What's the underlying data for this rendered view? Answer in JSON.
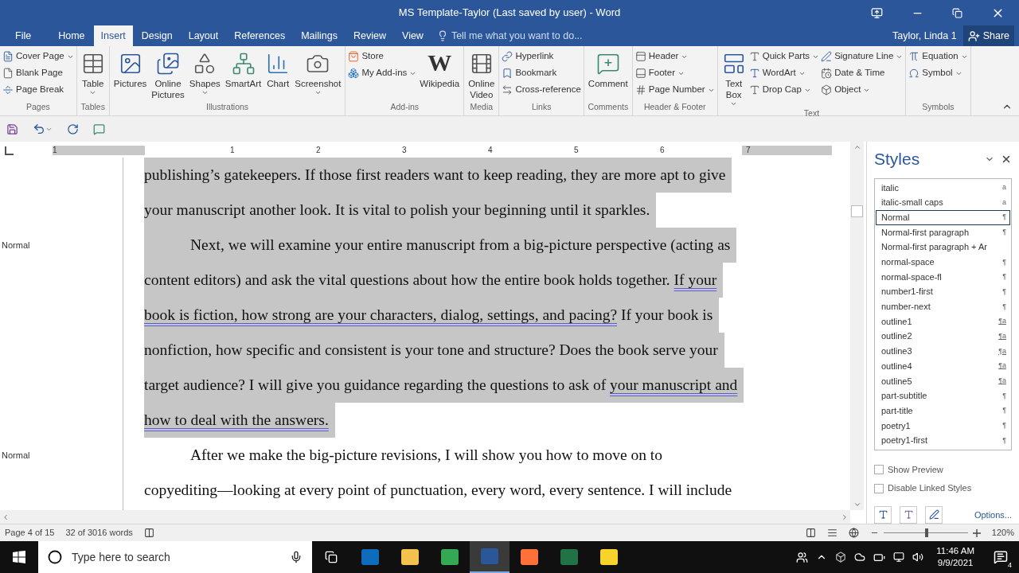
{
  "window": {
    "title": "MS Template-Taylor (Last saved by user) - Word"
  },
  "tabs": [
    {
      "label": "File",
      "selected": false
    },
    {
      "label": "Home",
      "selected": false
    },
    {
      "label": "Insert",
      "selected": true
    },
    {
      "label": "Design",
      "selected": false
    },
    {
      "label": "Layout",
      "selected": false
    },
    {
      "label": "References",
      "selected": false
    },
    {
      "label": "Mailings",
      "selected": false
    },
    {
      "label": "Review",
      "selected": false
    },
    {
      "label": "View",
      "selected": false
    }
  ],
  "tell_me": {
    "placeholder": "Tell me what you want to do..."
  },
  "user": "Taylor, Linda 1",
  "share": "Share",
  "ribbon": {
    "groups": [
      {
        "label": "Pages",
        "items": [
          {
            "label": "Cover Page",
            "kind": "small",
            "dropdown": true
          },
          {
            "label": "Blank Page",
            "kind": "small",
            "dropdown": false
          },
          {
            "label": "Page Break",
            "kind": "small",
            "dropdown": false
          }
        ]
      },
      {
        "label": "Tables",
        "items": [
          {
            "label": "Table",
            "kind": "large",
            "dropdown": true
          }
        ]
      },
      {
        "label": "Illustrations",
        "items": [
          {
            "label": "Pictures",
            "kind": "large",
            "dropdown": false
          },
          {
            "label": "Online Pictures",
            "kind": "large",
            "dropdown": false
          },
          {
            "label": "Shapes",
            "kind": "large",
            "dropdown": true
          },
          {
            "label": "SmartArt",
            "kind": "large",
            "dropdown": false
          },
          {
            "label": "Chart",
            "kind": "large",
            "dropdown": false
          },
          {
            "label": "Screenshot",
            "kind": "large",
            "dropdown": true
          }
        ]
      },
      {
        "label": "Add-ins",
        "items": [
          {
            "label": "Store",
            "kind": "small",
            "dropdown": false
          },
          {
            "label": "My Add-ins",
            "kind": "small",
            "dropdown": true
          },
          {
            "label": "Wikipedia",
            "kind": "large",
            "dropdown": false,
            "logo_text": "W"
          }
        ]
      },
      {
        "label": "Media",
        "items": [
          {
            "label": "Online Video",
            "kind": "large",
            "dropdown": false
          }
        ]
      },
      {
        "label": "Links",
        "items": [
          {
            "label": "Hyperlink",
            "kind": "small",
            "dropdown": false
          },
          {
            "label": "Bookmark",
            "kind": "small",
            "dropdown": false
          },
          {
            "label": "Cross-reference",
            "kind": "small",
            "dropdown": false
          }
        ]
      },
      {
        "label": "Comments",
        "items": [
          {
            "label": "Comment",
            "kind": "large",
            "dropdown": false
          }
        ]
      },
      {
        "label": "Header & Footer",
        "items": [
          {
            "label": "Header",
            "kind": "small",
            "dropdown": true
          },
          {
            "label": "Footer",
            "kind": "small",
            "dropdown": true
          },
          {
            "label": "Page Number",
            "kind": "small",
            "dropdown": true
          }
        ]
      },
      {
        "label": "Text",
        "items": [
          {
            "label": "Text Box",
            "kind": "large",
            "dropdown": true
          },
          {
            "label": "Quick Parts",
            "kind": "small",
            "dropdown": true
          },
          {
            "label": "WordArt",
            "kind": "small",
            "dropdown": true
          },
          {
            "label": "Drop Cap",
            "kind": "small",
            "dropdown": true
          },
          {
            "label": "Signature Line",
            "kind": "small",
            "dropdown": true
          },
          {
            "label": "Date & Time",
            "kind": "small",
            "dropdown": false
          },
          {
            "label": "Object",
            "kind": "small",
            "dropdown": true
          }
        ]
      },
      {
        "label": "Symbols",
        "items": [
          {
            "label": "Equation",
            "kind": "small",
            "dropdown": true
          },
          {
            "label": "Symbol",
            "kind": "small",
            "dropdown": true
          }
        ]
      }
    ]
  },
  "ruler": {
    "labels": [
      "1",
      "1",
      "2",
      "3",
      "4",
      "5",
      "6",
      "7"
    ]
  },
  "document": {
    "paragraphs": [
      {
        "selected": true,
        "first_line_indent": false,
        "lines": [
          [
            {
              "text": "publishing’s gatekeepers. If those first readers want to keep reading, they are more apt to give",
              "flagged": false
            }
          ],
          [
            {
              "text": "your manuscript another look. It is vital to polish your beginning until it sparkles.",
              "flagged": false
            }
          ]
        ]
      },
      {
        "style_label": "Normal",
        "selected": true,
        "first_line_indent": true,
        "lines": [
          [
            {
              "text": "Next, we will examine your entire manuscript from a big-picture perspective (acting as",
              "flagged": false
            }
          ],
          [
            {
              "text": "content editors) and ask the vital questions about how the entire book holds together. ",
              "flagged": false
            },
            {
              "text": "If your",
              "flagged": true
            }
          ],
          [
            {
              "text": "book is fiction, how strong are your characters, dialog, settings, and pacing?",
              "flagged": true
            },
            {
              "text": " If your book is",
              "flagged": false
            }
          ],
          [
            {
              "text": "nonfiction, how specific and consistent is your tone and structure? Does the book serve your",
              "flagged": false
            }
          ],
          [
            {
              "text": "target audience? I will give you guidance regarding the questions to ask of ",
              "flagged": false
            },
            {
              "text": "your manuscript and",
              "flagged": true
            }
          ],
          [
            {
              "text": "how to deal with the answers.",
              "flagged": true
            }
          ]
        ]
      },
      {
        "style_label": "Normal",
        "selected": false,
        "first_line_indent": true,
        "lines": [
          [
            {
              "text": "After we make the big-picture revisions, I will show you how to move on to",
              "flagged": false
            }
          ],
          [
            {
              "text": "copyediting—looking at every point of punctuation, every word, every sentence. I will include",
              "flagged": false
            }
          ]
        ]
      }
    ]
  },
  "styles_pane": {
    "title": "Styles",
    "items": [
      {
        "name": "italic",
        "marker": "a",
        "selected": false
      },
      {
        "name": "italic-small caps",
        "marker": "a",
        "selected": false
      },
      {
        "name": "Normal",
        "marker": "¶",
        "selected": true
      },
      {
        "name": "Normal-first paragraph",
        "marker": "¶",
        "selected": false
      },
      {
        "name": "Normal-first paragraph + Ar",
        "selected": false
      },
      {
        "name": "normal-space",
        "marker": "¶",
        "selected": false
      },
      {
        "name": "normal-space-fl",
        "marker": "¶",
        "selected": false
      },
      {
        "name": "number1-first",
        "marker": "¶",
        "selected": false
      },
      {
        "name": "number-next",
        "marker": "¶",
        "selected": false
      },
      {
        "name": "outline1",
        "marker": "¶a",
        "selected": false
      },
      {
        "name": "outline2",
        "marker": "¶a",
        "selected": false
      },
      {
        "name": "outline3",
        "marker": "¶a",
        "selected": false
      },
      {
        "name": "outline4",
        "marker": "¶a",
        "selected": false
      },
      {
        "name": "outline5",
        "marker": "¶a",
        "selected": false
      },
      {
        "name": "part-subtitle",
        "marker": "¶",
        "selected": false
      },
      {
        "name": "part-title",
        "marker": "¶",
        "selected": false
      },
      {
        "name": "poetry1",
        "marker": "¶",
        "selected": false
      },
      {
        "name": "poetry1-first",
        "marker": "¶",
        "selected": false
      }
    ],
    "options": [
      {
        "label": "Show Preview",
        "checked": false
      },
      {
        "label": "Disable Linked Styles",
        "checked": false
      }
    ],
    "options_link": "Options..."
  },
  "status_bar": {
    "page": "Page 4 of 15",
    "words": "32 of 3016 words",
    "zoom": {
      "level": 0.51,
      "reading": "120%"
    }
  },
  "taskbar": {
    "search": {
      "placeholder": "Type here to search"
    },
    "time": "11:46 AM",
    "date": "9/9/2021",
    "notifications": "4"
  }
}
